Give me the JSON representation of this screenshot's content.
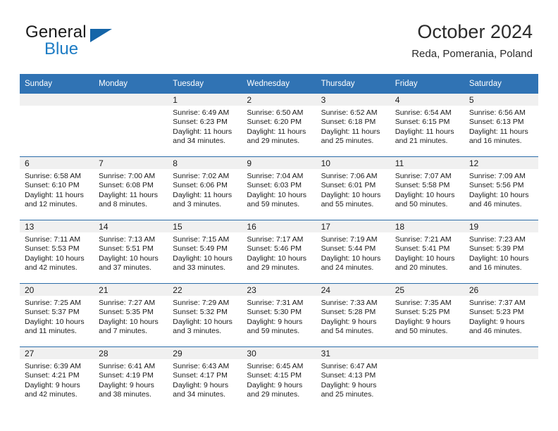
{
  "branding": {
    "logo_text_top": "General",
    "logo_text_bottom": "Blue",
    "logo_triangle_color": "#1565a8",
    "logo_blue_color": "#1d7cc4"
  },
  "header": {
    "title": "October 2024",
    "subtitle": "Reda, Pomerania, Poland"
  },
  "theme": {
    "header_row_background": "#3073b4",
    "header_row_text": "#ffffff",
    "daynum_background": "#f0f0f0",
    "week_separator": "#2b6ca8"
  },
  "weekday_headers": [
    "Sunday",
    "Monday",
    "Tuesday",
    "Wednesday",
    "Thursday",
    "Friday",
    "Saturday"
  ],
  "labels": {
    "sunrise_prefix": "Sunrise:",
    "sunset_prefix": "Sunset:",
    "daylight_prefix": "Daylight:"
  },
  "weeks": [
    [
      {
        "day": "",
        "sunrise": "",
        "sunset": "",
        "daylight_line1": "",
        "daylight_line2": ""
      },
      {
        "day": "",
        "sunrise": "",
        "sunset": "",
        "daylight_line1": "",
        "daylight_line2": ""
      },
      {
        "day": "1",
        "sunrise": "Sunrise: 6:49 AM",
        "sunset": "Sunset: 6:23 PM",
        "daylight_line1": "Daylight: 11 hours",
        "daylight_line2": "and 34 minutes."
      },
      {
        "day": "2",
        "sunrise": "Sunrise: 6:50 AM",
        "sunset": "Sunset: 6:20 PM",
        "daylight_line1": "Daylight: 11 hours",
        "daylight_line2": "and 29 minutes."
      },
      {
        "day": "3",
        "sunrise": "Sunrise: 6:52 AM",
        "sunset": "Sunset: 6:18 PM",
        "daylight_line1": "Daylight: 11 hours",
        "daylight_line2": "and 25 minutes."
      },
      {
        "day": "4",
        "sunrise": "Sunrise: 6:54 AM",
        "sunset": "Sunset: 6:15 PM",
        "daylight_line1": "Daylight: 11 hours",
        "daylight_line2": "and 21 minutes."
      },
      {
        "day": "5",
        "sunrise": "Sunrise: 6:56 AM",
        "sunset": "Sunset: 6:13 PM",
        "daylight_line1": "Daylight: 11 hours",
        "daylight_line2": "and 16 minutes."
      }
    ],
    [
      {
        "day": "6",
        "sunrise": "Sunrise: 6:58 AM",
        "sunset": "Sunset: 6:10 PM",
        "daylight_line1": "Daylight: 11 hours",
        "daylight_line2": "and 12 minutes."
      },
      {
        "day": "7",
        "sunrise": "Sunrise: 7:00 AM",
        "sunset": "Sunset: 6:08 PM",
        "daylight_line1": "Daylight: 11 hours",
        "daylight_line2": "and 8 minutes."
      },
      {
        "day": "8",
        "sunrise": "Sunrise: 7:02 AM",
        "sunset": "Sunset: 6:06 PM",
        "daylight_line1": "Daylight: 11 hours",
        "daylight_line2": "and 3 minutes."
      },
      {
        "day": "9",
        "sunrise": "Sunrise: 7:04 AM",
        "sunset": "Sunset: 6:03 PM",
        "daylight_line1": "Daylight: 10 hours",
        "daylight_line2": "and 59 minutes."
      },
      {
        "day": "10",
        "sunrise": "Sunrise: 7:06 AM",
        "sunset": "Sunset: 6:01 PM",
        "daylight_line1": "Daylight: 10 hours",
        "daylight_line2": "and 55 minutes."
      },
      {
        "day": "11",
        "sunrise": "Sunrise: 7:07 AM",
        "sunset": "Sunset: 5:58 PM",
        "daylight_line1": "Daylight: 10 hours",
        "daylight_line2": "and 50 minutes."
      },
      {
        "day": "12",
        "sunrise": "Sunrise: 7:09 AM",
        "sunset": "Sunset: 5:56 PM",
        "daylight_line1": "Daylight: 10 hours",
        "daylight_line2": "and 46 minutes."
      }
    ],
    [
      {
        "day": "13",
        "sunrise": "Sunrise: 7:11 AM",
        "sunset": "Sunset: 5:53 PM",
        "daylight_line1": "Daylight: 10 hours",
        "daylight_line2": "and 42 minutes."
      },
      {
        "day": "14",
        "sunrise": "Sunrise: 7:13 AM",
        "sunset": "Sunset: 5:51 PM",
        "daylight_line1": "Daylight: 10 hours",
        "daylight_line2": "and 37 minutes."
      },
      {
        "day": "15",
        "sunrise": "Sunrise: 7:15 AM",
        "sunset": "Sunset: 5:49 PM",
        "daylight_line1": "Daylight: 10 hours",
        "daylight_line2": "and 33 minutes."
      },
      {
        "day": "16",
        "sunrise": "Sunrise: 7:17 AM",
        "sunset": "Sunset: 5:46 PM",
        "daylight_line1": "Daylight: 10 hours",
        "daylight_line2": "and 29 minutes."
      },
      {
        "day": "17",
        "sunrise": "Sunrise: 7:19 AM",
        "sunset": "Sunset: 5:44 PM",
        "daylight_line1": "Daylight: 10 hours",
        "daylight_line2": "and 24 minutes."
      },
      {
        "day": "18",
        "sunrise": "Sunrise: 7:21 AM",
        "sunset": "Sunset: 5:41 PM",
        "daylight_line1": "Daylight: 10 hours",
        "daylight_line2": "and 20 minutes."
      },
      {
        "day": "19",
        "sunrise": "Sunrise: 7:23 AM",
        "sunset": "Sunset: 5:39 PM",
        "daylight_line1": "Daylight: 10 hours",
        "daylight_line2": "and 16 minutes."
      }
    ],
    [
      {
        "day": "20",
        "sunrise": "Sunrise: 7:25 AM",
        "sunset": "Sunset: 5:37 PM",
        "daylight_line1": "Daylight: 10 hours",
        "daylight_line2": "and 11 minutes."
      },
      {
        "day": "21",
        "sunrise": "Sunrise: 7:27 AM",
        "sunset": "Sunset: 5:35 PM",
        "daylight_line1": "Daylight: 10 hours",
        "daylight_line2": "and 7 minutes."
      },
      {
        "day": "22",
        "sunrise": "Sunrise: 7:29 AM",
        "sunset": "Sunset: 5:32 PM",
        "daylight_line1": "Daylight: 10 hours",
        "daylight_line2": "and 3 minutes."
      },
      {
        "day": "23",
        "sunrise": "Sunrise: 7:31 AM",
        "sunset": "Sunset: 5:30 PM",
        "daylight_line1": "Daylight: 9 hours",
        "daylight_line2": "and 59 minutes."
      },
      {
        "day": "24",
        "sunrise": "Sunrise: 7:33 AM",
        "sunset": "Sunset: 5:28 PM",
        "daylight_line1": "Daylight: 9 hours",
        "daylight_line2": "and 54 minutes."
      },
      {
        "day": "25",
        "sunrise": "Sunrise: 7:35 AM",
        "sunset": "Sunset: 5:25 PM",
        "daylight_line1": "Daylight: 9 hours",
        "daylight_line2": "and 50 minutes."
      },
      {
        "day": "26",
        "sunrise": "Sunrise: 7:37 AM",
        "sunset": "Sunset: 5:23 PM",
        "daylight_line1": "Daylight: 9 hours",
        "daylight_line2": "and 46 minutes."
      }
    ],
    [
      {
        "day": "27",
        "sunrise": "Sunrise: 6:39 AM",
        "sunset": "Sunset: 4:21 PM",
        "daylight_line1": "Daylight: 9 hours",
        "daylight_line2": "and 42 minutes."
      },
      {
        "day": "28",
        "sunrise": "Sunrise: 6:41 AM",
        "sunset": "Sunset: 4:19 PM",
        "daylight_line1": "Daylight: 9 hours",
        "daylight_line2": "and 38 minutes."
      },
      {
        "day": "29",
        "sunrise": "Sunrise: 6:43 AM",
        "sunset": "Sunset: 4:17 PM",
        "daylight_line1": "Daylight: 9 hours",
        "daylight_line2": "and 34 minutes."
      },
      {
        "day": "30",
        "sunrise": "Sunrise: 6:45 AM",
        "sunset": "Sunset: 4:15 PM",
        "daylight_line1": "Daylight: 9 hours",
        "daylight_line2": "and 29 minutes."
      },
      {
        "day": "31",
        "sunrise": "Sunrise: 6:47 AM",
        "sunset": "Sunset: 4:13 PM",
        "daylight_line1": "Daylight: 9 hours",
        "daylight_line2": "and 25 minutes."
      },
      {
        "day": "",
        "sunrise": "",
        "sunset": "",
        "daylight_line1": "",
        "daylight_line2": ""
      },
      {
        "day": "",
        "sunrise": "",
        "sunset": "",
        "daylight_line1": "",
        "daylight_line2": ""
      }
    ]
  ]
}
